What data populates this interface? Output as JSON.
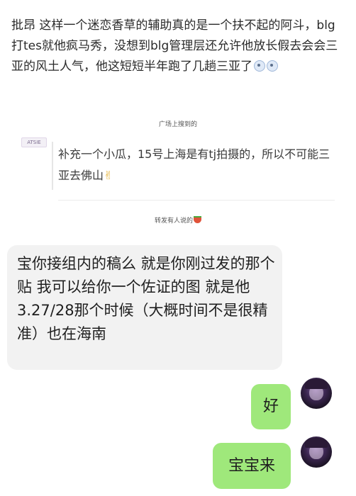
{
  "intro_text": "批昂 这样一个迷恋香草的辅助真的是一个扶不起的阿斗，blg打tes就他疯马秀，没想到blg管理层还允许他放长假去会会三亚的风土人气，他这短短半年跑了几趟三亚了",
  "intro_emojis": [
    "eye-roll-emoji",
    "eye-roll-emoji"
  ],
  "caption_1": "广场上搜到的",
  "snippet_avatar_text": "ATSIE",
  "quote_text": "补充一个小瓜，15号上海是有tj拍摄的，所以不可能三亚去佛山",
  "quote_emoji": "✌",
  "caption_2": "转发有人说的",
  "caption_2_icon": "watermelon-icon",
  "chat": {
    "left_message": "宝你接组内的稿么 就是你刚过发的那个贴 我可以给你一个佐证的图 就是他3.27/28那个时候（大概时间不是很精准）也在海南",
    "right_message_1": "好",
    "right_message_2": "宝宝来"
  },
  "colors": {
    "right_bubble": "#9fe87b",
    "left_bubble": "#f2f2f2",
    "caption_text": "#555555"
  }
}
